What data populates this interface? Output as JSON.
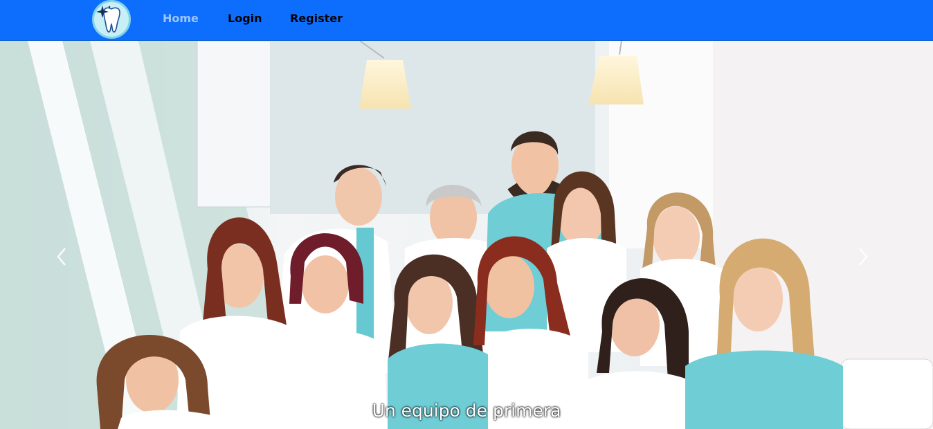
{
  "navbar": {
    "brand_icon": "tooth-sparkle-icon",
    "links": [
      {
        "label": "Home",
        "active": true
      },
      {
        "label": "Login",
        "active": false
      },
      {
        "label": "Register",
        "active": false
      }
    ],
    "colors": {
      "background": "#0d6efd",
      "active_link": "#9ec5fe",
      "link": "#000000"
    }
  },
  "carousel": {
    "slide": {
      "image_subject": "dental-team-group-photo",
      "caption": "Un equipo de primera"
    },
    "controls": {
      "prev_icon": "chevron-left-icon",
      "next_icon": "chevron-right-icon"
    }
  }
}
